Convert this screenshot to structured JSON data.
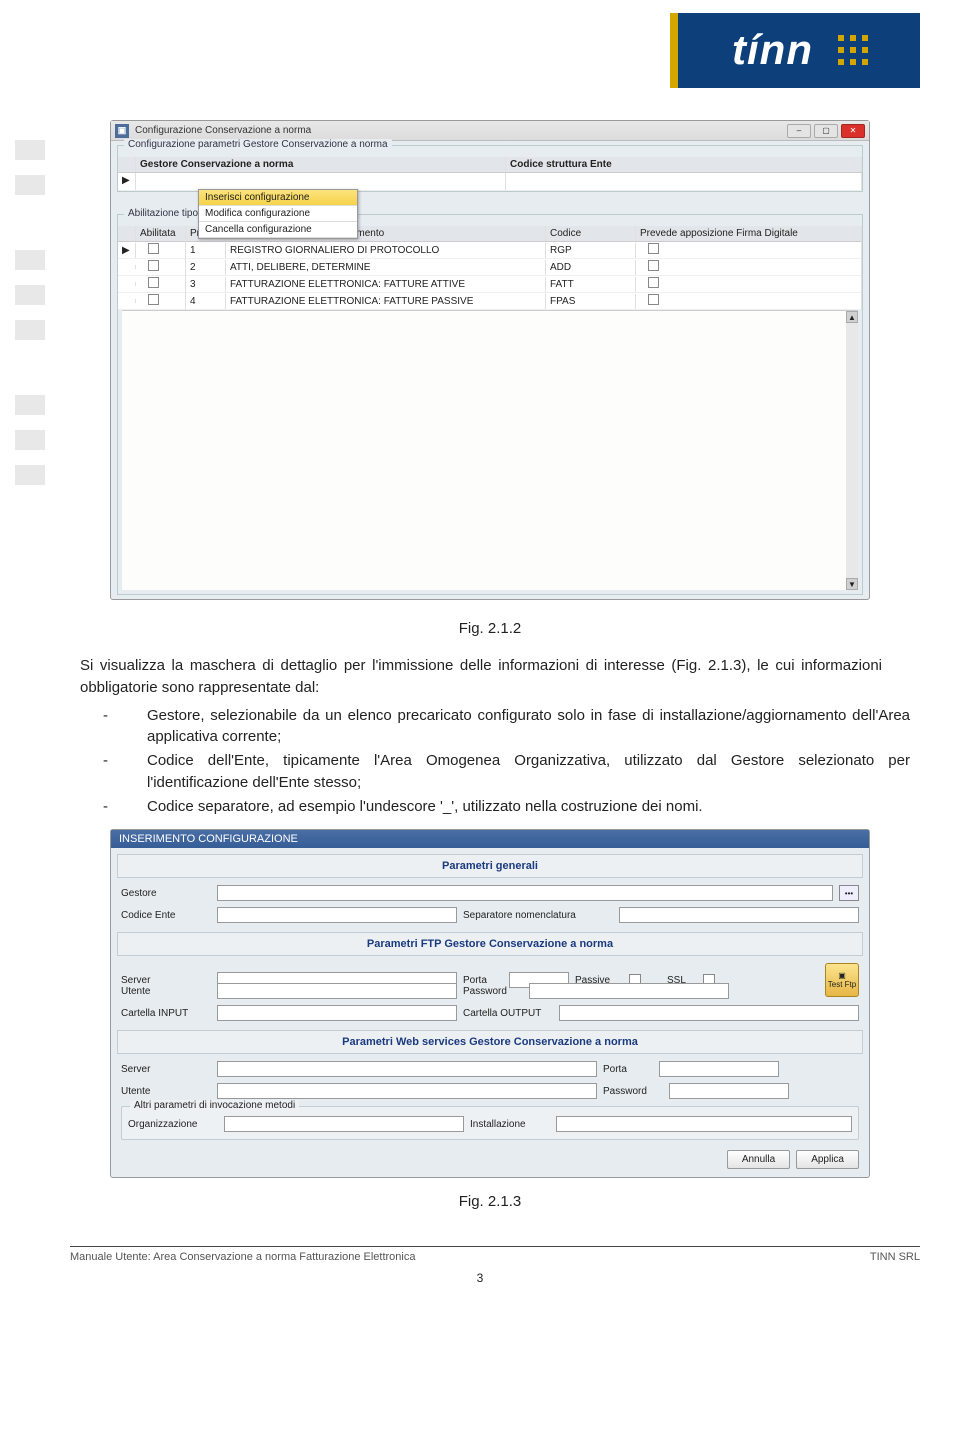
{
  "logo": {
    "text": "tínn"
  },
  "window1": {
    "title": "Configurazione Conservazione a norma",
    "group_legend": "Configurazione parametri Gestore Conservazione a norma",
    "col_gestore": "Gestore Conservazione a norma",
    "col_codice_strutt": "Codice struttura Ente",
    "ctx_insert": "Inserisci configurazione",
    "ctx_modify": "Modifica configurazione",
    "ctx_delete": "Cancella configurazione",
    "group2_legend": "Abilitazione tipologia",
    "h_abilitata": "Abilitata",
    "h_prog": "Prog.",
    "h_tipologia": "Tipologia Pacchetto di Versamento",
    "h_codice": "Codice",
    "h_firma": "Prevede apposizione Firma Digitale",
    "rows": [
      {
        "prog": "1",
        "tip": "REGISTRO GIORNALIERO DI PROTOCOLLO",
        "cod": "RGP"
      },
      {
        "prog": "2",
        "tip": "ATTI, DELIBERE, DETERMINE",
        "cod": "ADD"
      },
      {
        "prog": "3",
        "tip": "FATTURAZIONE ELETTRONICA: FATTURE ATTIVE",
        "cod": "FATT"
      },
      {
        "prog": "4",
        "tip": "FATTURAZIONE ELETTRONICA: FATTURE PASSIVE",
        "cod": "FPAS"
      }
    ]
  },
  "caption1": "Fig. 2.1.2",
  "para1": "Si visualizza la maschera di dettaglio per l'immissione delle informazioni di interesse (Fig. 2.1.3), le cui informazioni obbligatorie sono rappresentate dal:",
  "bullets": {
    "b1": "Gestore, selezionabile da un elenco precaricato configurato solo in fase di installazione/aggiornamento dell'Area applicativa corrente;",
    "b2": "Codice dell'Ente, tipicamente l'Area Omogenea Organizzativa, utilizzato dal Gestore selezionato per l'identificazione dell'Ente stesso;",
    "b3": "Codice separatore, ad esempio l'undescore '_', utilizzato nella costruzione dei nomi."
  },
  "window2": {
    "title": "INSERIMENTO CONFIGURAZIONE",
    "section1": "Parametri generali",
    "lbl_gestore": "Gestore",
    "lbl_codice_ente": "Codice Ente",
    "lbl_separatore": "Separatore nomenclatura",
    "section2": "Parametri FTP Gestore Conservazione a norma",
    "lbl_server": "Server",
    "lbl_porta": "Porta",
    "lbl_passive": "Passive",
    "lbl_ssl": "SSL",
    "lbl_utente": "Utente",
    "lbl_password": "Password",
    "lbl_test_ftp": "Test Ftp",
    "lbl_cartella_in": "Cartella INPUT",
    "lbl_cartella_out": "Cartella OUTPUT",
    "section3": "Parametri Web services Gestore Conservazione a norma",
    "sub_legend": "Altri parametri di invocazione metodi",
    "lbl_organizzazione": "Organizzazione",
    "lbl_installazione": "Installazione",
    "btn_annulla": "Annulla",
    "btn_applica": "Applica"
  },
  "caption2": "Fig. 2.1.3",
  "footer_left": "Manuale Utente: Area Conservazione a norma Fatturazione Elettronica",
  "footer_right": "TINN SRL",
  "page_number": "3"
}
